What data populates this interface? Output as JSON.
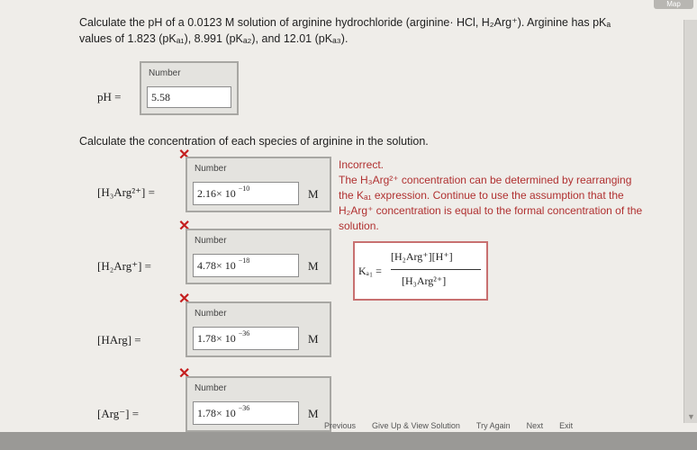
{
  "question1": {
    "line1": "Calculate the pH of a 0.0123 M solution of arginine hydrochloride (arginine· HCl, H₂Arg⁺). Arginine has pKₐ",
    "line2": "values of 1.823 (pKₐ₁), 8.991 (pKₐ₂), and 12.01 (pKₐ₃)."
  },
  "ph_answer": {
    "label": "pH =",
    "field_label": "Number",
    "value": "5.58"
  },
  "question2": "Calculate the concentration of each species of arginine in the solution.",
  "species": [
    {
      "name": "[H₃Arg²⁺] =",
      "field_label": "Number",
      "mantissa": "2.16× 10",
      "exponent": "−10",
      "unit": "M"
    },
    {
      "name": "[H₂Arg⁺] =",
      "field_label": "Number",
      "mantissa": "4.78× 10",
      "exponent": "−18",
      "unit": "M"
    },
    {
      "name": "[HArg] =",
      "field_label": "Number",
      "mantissa": "1.78× 10",
      "exponent": "−36",
      "unit": "M"
    },
    {
      "name": "[Arg⁻] =",
      "field_label": "Number",
      "mantissa": "1.78× 10",
      "exponent": "−36",
      "unit": "M"
    }
  ],
  "feedback": {
    "title": "Incorrect.",
    "body": "The H₃Arg²⁺ concentration can be determined by rearranging the Kₐ₁ expression. Continue to use the assumption that the H₂Arg⁺ concentration is equal to the formal concentration of the solution.",
    "formula_lhs": "Kₐ₁ =",
    "formula_num": "[H₂Arg⁺][H⁺]",
    "formula_den": "[H₃Arg²⁺]"
  },
  "top_button": "Map",
  "bottom_buttons": [
    "Previous",
    "Give Up & View Solution",
    "Try Again",
    "Next",
    "Exit"
  ]
}
